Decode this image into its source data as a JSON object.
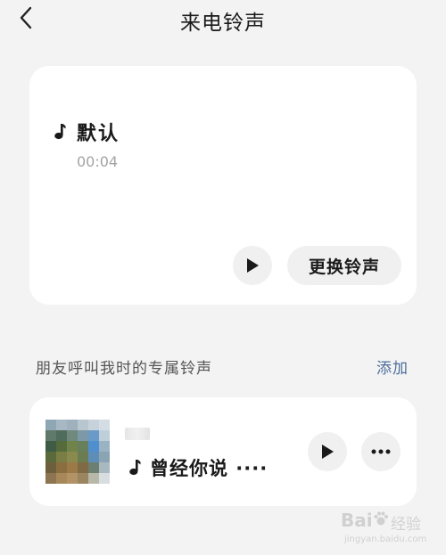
{
  "header": {
    "title": "来电铃声",
    "back_icon": "chevron-left-icon"
  },
  "current_ringtone": {
    "name": "默认",
    "duration": "00:04",
    "play_icon": "play-icon",
    "change_label": "更换铃声"
  },
  "contacts_section": {
    "title": "朋友呼叫我时的专属铃声",
    "add_label": "添加"
  },
  "contact_ringtone": {
    "song": "曾经你说 ····",
    "play_icon": "play-icon",
    "more_icon": "more-horizontal-icon"
  },
  "watermark": {
    "brand": "Bai",
    "brand_suffix": "经验",
    "url": "jingyan.baidu.com"
  },
  "colors": {
    "background": "#f3f3f3",
    "card": "#ffffff",
    "button_bg": "#f0f0f0",
    "link": "#4d6f9c",
    "muted_text": "#a3a3a3"
  }
}
